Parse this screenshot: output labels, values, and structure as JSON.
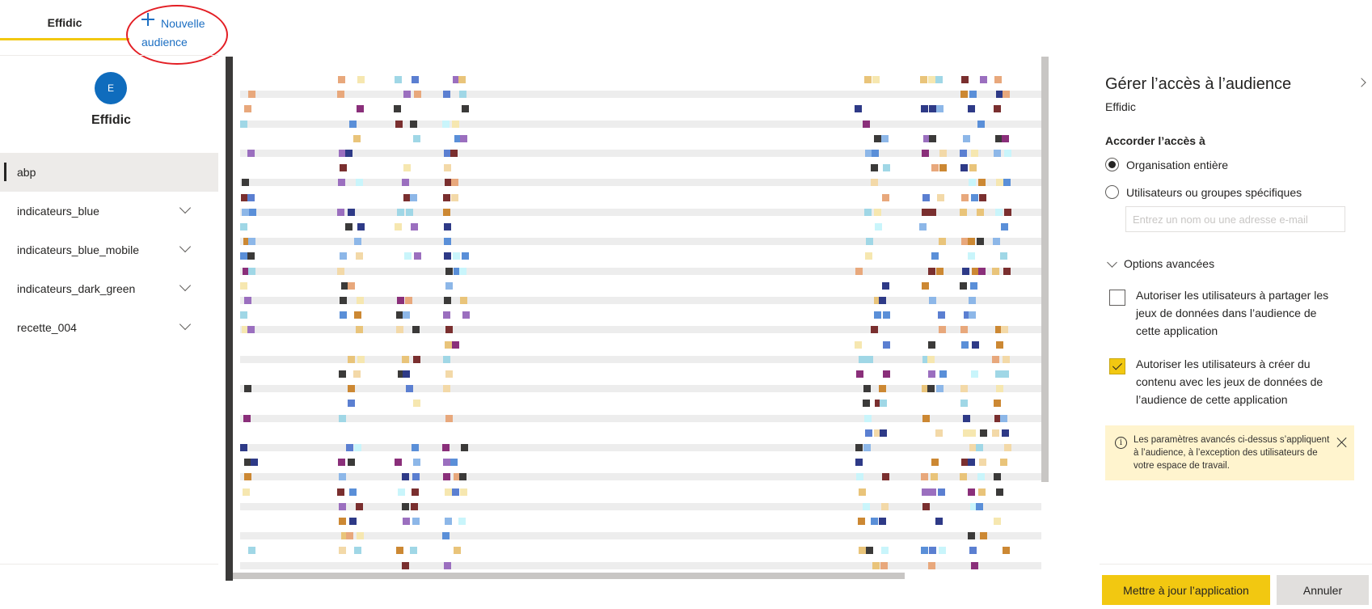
{
  "tabs": {
    "workspace_label": "Effidic",
    "new_audience_line1": "Nouvelle",
    "new_audience_line2": "audience"
  },
  "sidebar": {
    "avatar_letter": "E",
    "workspace_name": "Effidic",
    "audiences": [
      {
        "label": "abp",
        "selected": true
      },
      {
        "label": "indicateurs_blue",
        "selected": false
      },
      {
        "label": "indicateurs_blue_mobile",
        "selected": false
      },
      {
        "label": "indicateurs_dark_green",
        "selected": false
      },
      {
        "label": "recette_004",
        "selected": false
      }
    ]
  },
  "panel": {
    "title": "Gérer l’accès à l’audience",
    "subtitle": "Effidic",
    "grant_label": "Accorder l’accès à",
    "radio_org": "Organisation entière",
    "radio_specific": "Utilisateurs ou groupes spécifiques",
    "selected_option": "Organisation entière",
    "name_input_placeholder": "Entrez un nom ou une adresse e-mail",
    "advanced_label": "Options avancées",
    "checkbox_share": "Autoriser les utilisateurs à partager les jeux de données dans l’audience de cette application",
    "checkbox_share_checked": false,
    "checkbox_create": "Autoriser les utilisateurs à créer du contenu avec les jeux de données de l’audience de cette application",
    "checkbox_create_checked": true,
    "notice": "Les paramètres avancés ci-dessus s’appliquent à l’audience, à l’exception des utilisateurs de votre espace de travail."
  },
  "footer": {
    "update_button": "Mettre à jour l’application",
    "cancel_button": "Annuler"
  },
  "colors": {
    "accent": "#f2c811",
    "link": "#1b6ec2",
    "avatar": "#0f6cbd",
    "annotation": "#e31e24",
    "notice_bg": "#fff4ce"
  }
}
